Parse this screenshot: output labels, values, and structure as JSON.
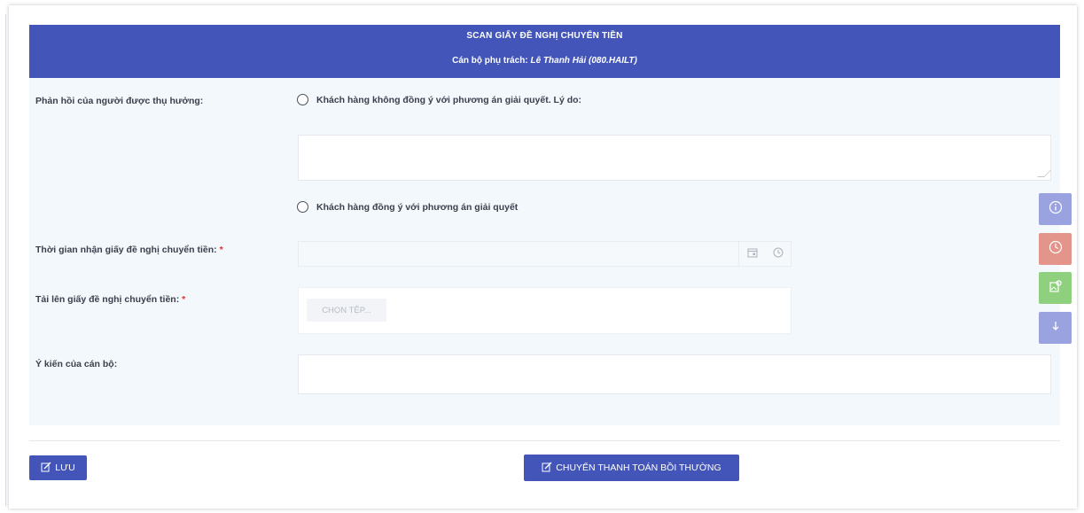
{
  "header": {
    "title": "SCAN GIẤY ĐỀ NGHỊ CHUYỂN TIỀN",
    "officer_prefix": "Cán bộ phụ trách:",
    "officer_name": "Lê Thanh Hải (080.HAILT)"
  },
  "form": {
    "feedback_label": "Phản hồi của người được thụ hưởng:",
    "option_disagree": "Khách hàng không đồng ý với phương án giải quyết. Lý do:",
    "option_agree": "Khách hàng đồng ý với phương án giải quyết",
    "receive_time_label": "Thời gian nhận giấy đề nghị chuyển tiền:",
    "upload_label": "Tải lên giấy đề nghị chuyển tiền:",
    "choose_file": "CHỌN TỆP...",
    "officer_opinion_label": "Ý kiến của cán bộ:",
    "required_mark": "*"
  },
  "actions": {
    "save": "LƯU",
    "transfer": "CHUYỂN THANH TOÁN BỒI THƯỜNG"
  },
  "side_buttons": [
    {
      "icon": "info-icon",
      "color": "#9aa2e0"
    },
    {
      "icon": "clock-icon",
      "color": "#e3958c"
    },
    {
      "icon": "image-icon",
      "color": "#8ed07e"
    },
    {
      "icon": "arrow-down-icon",
      "color": "#9aa2e0"
    }
  ],
  "colors": {
    "primary": "#4355b9",
    "required": "#e0322b"
  }
}
